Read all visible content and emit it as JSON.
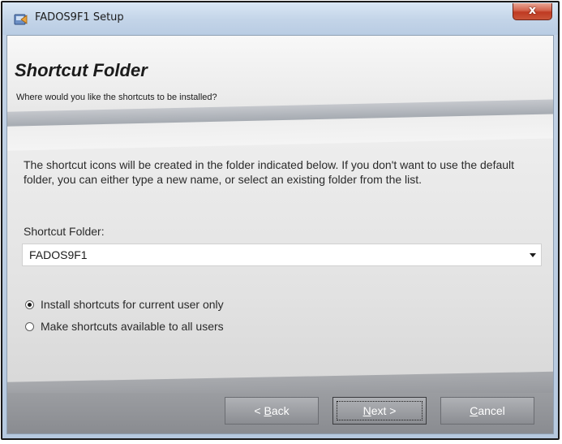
{
  "window": {
    "title": "FADOS9F1 Setup",
    "close_glyph": "x",
    "icon": "setup-installer-icon"
  },
  "header": {
    "title": "Shortcut Folder",
    "subtitle": "Where would you like the shortcuts to be installed?"
  },
  "body": {
    "description": "The shortcut icons will be created in the folder indicated below. If you don't want to use the default folder, you can either type a new name, or select an existing folder from the list.",
    "folder_label": "Shortcut Folder:",
    "folder_value": "FADOS9F1",
    "options": [
      {
        "label": "Install shortcuts for current user only",
        "selected": true
      },
      {
        "label": "Make shortcuts available to all users",
        "selected": false
      }
    ]
  },
  "buttons": {
    "back_prefix": "< ",
    "back_mnemonic": "B",
    "back_rest": "ack",
    "next_mnemonic": "N",
    "next_rest": "ext >",
    "cancel_mnemonic": "C",
    "cancel_rest": "ancel"
  },
  "colors": {
    "titlebar": "#c3d4e8",
    "close_button": "#c9503a",
    "footer": "#8f9196"
  }
}
